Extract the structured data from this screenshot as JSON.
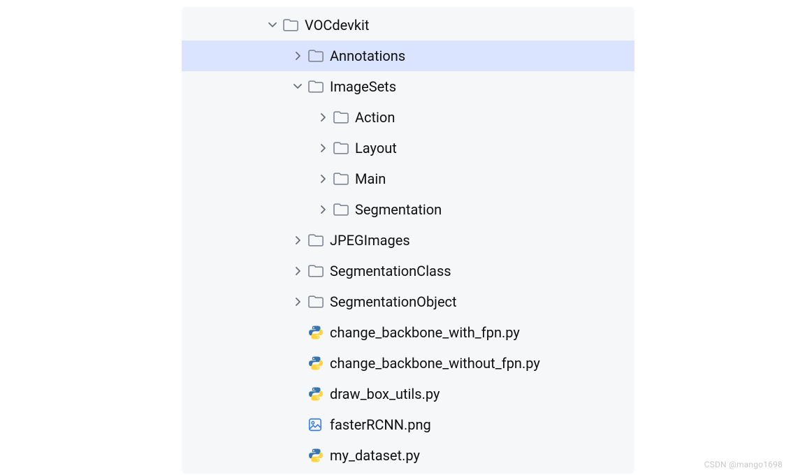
{
  "tree": {
    "root": {
      "name": "VOCdevkit",
      "type": "folder",
      "expanded": true,
      "children": [
        {
          "name": "Annotations",
          "type": "folder",
          "expanded": false,
          "selected": true
        },
        {
          "name": "ImageSets",
          "type": "folder",
          "expanded": true,
          "children": [
            {
              "name": "Action",
              "type": "folder",
              "expanded": false
            },
            {
              "name": "Layout",
              "type": "folder",
              "expanded": false
            },
            {
              "name": "Main",
              "type": "folder",
              "expanded": false
            },
            {
              "name": "Segmentation",
              "type": "folder",
              "expanded": false
            }
          ]
        },
        {
          "name": "JPEGImages",
          "type": "folder",
          "expanded": false
        },
        {
          "name": "SegmentationClass",
          "type": "folder",
          "expanded": false
        },
        {
          "name": "SegmentationObject",
          "type": "folder",
          "expanded": false
        },
        {
          "name": "change_backbone_with_fpn.py",
          "type": "python"
        },
        {
          "name": "change_backbone_without_fpn.py",
          "type": "python"
        },
        {
          "name": "draw_box_utils.py",
          "type": "python"
        },
        {
          "name": "fasterRCNN.png",
          "type": "image"
        },
        {
          "name": "my_dataset.py",
          "type": "python"
        }
      ]
    }
  },
  "watermark": "CSDN @mango1698"
}
